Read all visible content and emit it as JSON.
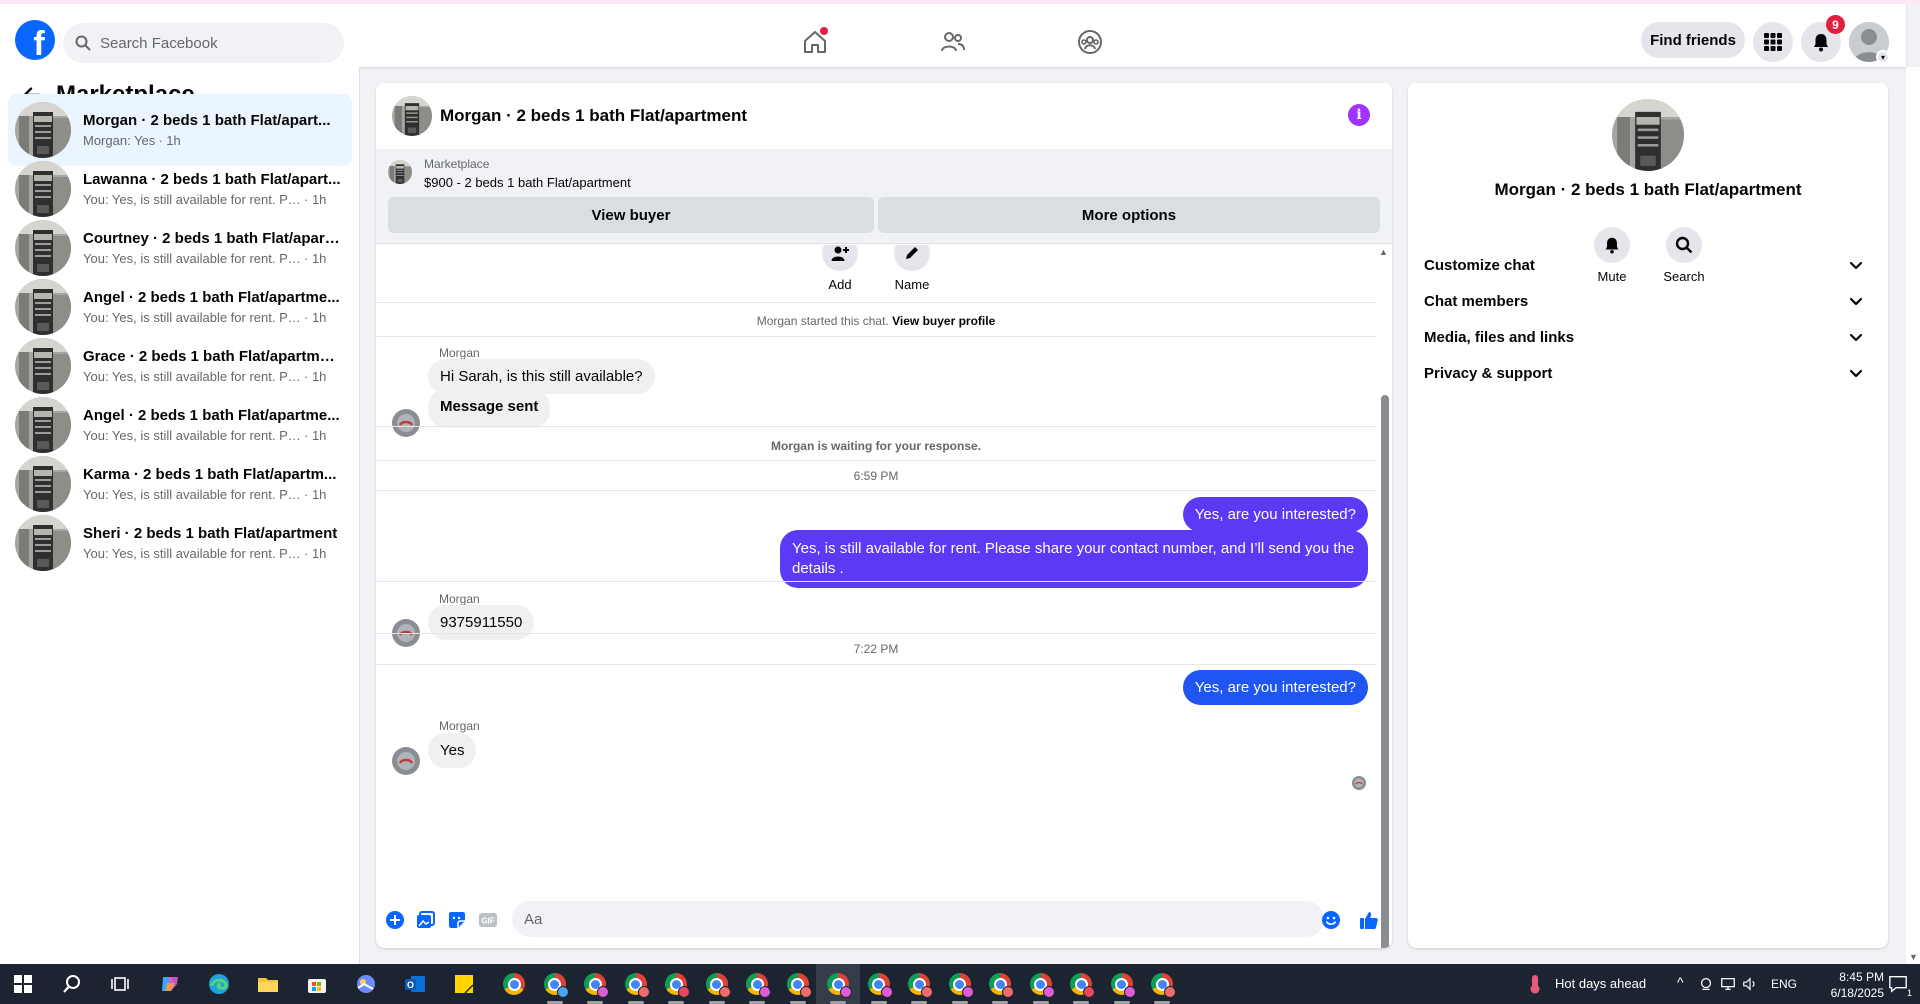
{
  "header": {
    "logo": "facebook-logo",
    "search_placeholder": "Search Facebook",
    "nav": [
      {
        "name": "home-icon",
        "has_dot": true
      },
      {
        "name": "friends-icon"
      },
      {
        "name": "groups-icon"
      }
    ],
    "find_friends_label": "Find friends",
    "notifications_count": "9"
  },
  "sidebar": {
    "title": "Marketplace",
    "conversations": [
      {
        "title": "Morgan · 2 beds 1 bath Flat/apart...",
        "snippet": "Morgan: Yes",
        "time": " · 1h",
        "active": true
      },
      {
        "title": "Lawanna · 2 beds 1 bath Flat/apart...",
        "snippet": "You: Yes, is still available for rent. Plea...",
        "time": " · 1h"
      },
      {
        "title": "Courtney · 2 beds 1 bath Flat/apart...",
        "snippet": "You: Yes, is still available for rent. Plea...",
        "time": " · 1h"
      },
      {
        "title": "Angel · 2 beds 1 bath Flat/apartme...",
        "snippet": "You: Yes, is still available for rent. Plea...",
        "time": " · 1h"
      },
      {
        "title": "Grace · 2 beds 1 bath Flat/apartment",
        "snippet": "You: Yes, is still available for rent. Plea...",
        "time": " · 1h"
      },
      {
        "title": "Angel · 2 beds 1 bath Flat/apartme...",
        "snippet": "You: Yes, is still available for rent. Plea...",
        "time": " · 1h"
      },
      {
        "title": "Karma · 2 beds 1 bath Flat/apartm...",
        "snippet": "You: Yes, is still available for rent. Plea...",
        "time": " · 1h"
      },
      {
        "title": "Sheri · 2 beds 1 bath Flat/apartment",
        "snippet": "You: Yes, is still available for rent. Plea...",
        "time": " · 1h"
      }
    ]
  },
  "chat": {
    "title": "Morgan · 2 beds 1 bath Flat/apartment",
    "banner": {
      "label": "Marketplace",
      "price_line": "$900 - 2 beds 1 bath Flat/apartment",
      "view_buyer": "View buyer",
      "more_options": "More options"
    },
    "actions": {
      "add": "Add",
      "name": "Name"
    },
    "started_text": "Morgan started this chat.",
    "view_profile": "View buyer profile",
    "sender": "Morgan",
    "msg1": "Hi Sarah, is this still available?",
    "msg2": "Message sent",
    "waiting": "Morgan is waiting for your response.",
    "time1": "6:59 PM",
    "out1": "Yes, are you interested?",
    "out2": "Yes, is still available for rent. Please share your contact number, and I’ll send you the details .",
    "msg3": "9375911550",
    "time2": "7:22 PM",
    "out3": "Yes, are you interested?",
    "msg4": "Yes",
    "composer_placeholder": "Aa"
  },
  "details": {
    "name": "Morgan · 2 beds 1 bath Flat/apartment",
    "mute": "Mute",
    "search": "Search",
    "sections": [
      "Customize chat",
      "Chat members",
      "Media, files and links",
      "Privacy & support"
    ]
  },
  "taskbar": {
    "weather": "Hot days ahead",
    "lang": "ENG",
    "time": "8:45 PM",
    "date": "6/18/2025",
    "notif_count": "1"
  },
  "colors": {
    "brand": "#0866ff",
    "outgoing_bubble": "#5b39f5",
    "outgoing_bubble_last": "#1f55f0",
    "badge": "#e41e3f"
  }
}
